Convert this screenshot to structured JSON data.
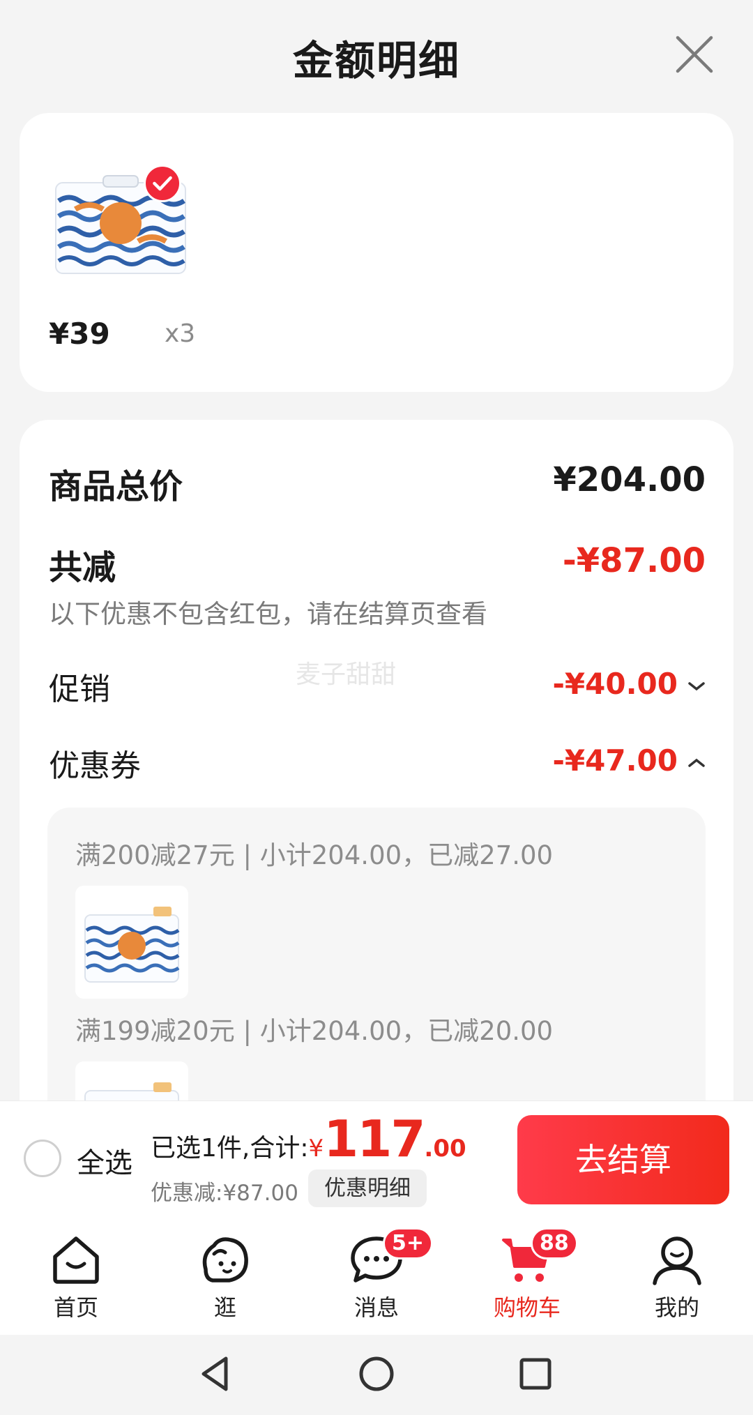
{
  "header": {
    "title": "金额明细"
  },
  "product": {
    "price": "¥39",
    "qty": "x3"
  },
  "detail": {
    "total_label": "商品总价",
    "total_value": "¥204.00",
    "reduce_label": "共减",
    "reduce_value": "-¥87.00",
    "note": "以下优惠不包含红包，请在结算页查看",
    "promo_label": "促销",
    "promo_value": "-¥40.00",
    "coupon_label": "优惠券",
    "coupon_value": "-¥47.00",
    "watermark": "麦子甜甜"
  },
  "coupons": [
    {
      "text": "满200减27元 | 小计204.00，已减27.00"
    },
    {
      "text": "满199减20元 | 小计204.00，已减20.00"
    }
  ],
  "checkout": {
    "select_all": "全选",
    "prefix": "已选1件,合计:",
    "symbol": "¥",
    "int": "117",
    "dec": ".00",
    "discount": "优惠减:¥87.00",
    "detail_btn": "优惠明细",
    "submit": "去结算"
  },
  "tabs": [
    {
      "label": "首页",
      "icon": "home-icon"
    },
    {
      "label": "逛",
      "icon": "browse-icon"
    },
    {
      "label": "消息",
      "icon": "message-icon",
      "badge": "5+"
    },
    {
      "label": "购物车",
      "icon": "cart-icon",
      "badge": "88"
    },
    {
      "label": "我的",
      "icon": "profile-icon"
    }
  ],
  "colors": {
    "accent": "#e8281e",
    "badge": "#f0283a",
    "background": "#f4f4f4"
  }
}
